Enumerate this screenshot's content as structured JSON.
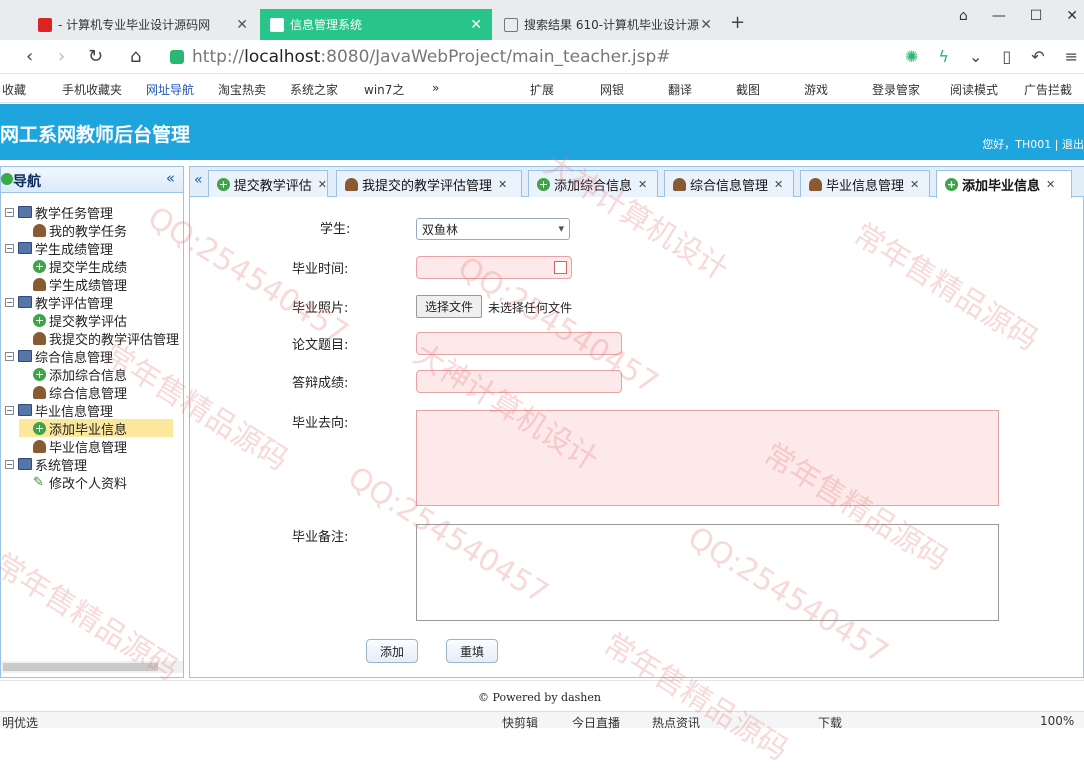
{
  "browser": {
    "tabs": [
      {
        "title": "- 计算机专业毕业设计源码网"
      },
      {
        "title": "信息管理系统"
      },
      {
        "title": "搜索结果 610-计算机毕业设计源"
      }
    ],
    "url_host": "localhost",
    "url_prefix": "http://",
    "url_rest": ":8080/JavaWebProject/main_teacher.jsp#",
    "bookmarks": [
      "收藏",
      "手机收藏夹",
      "网址导航",
      "淘宝热卖",
      "系统之家",
      "win7之",
      "»"
    ],
    "toolbar": [
      "扩展",
      "网银",
      "翻译",
      "截图",
      "游戏",
      "登录管家",
      "阅读模式",
      "广告拦截"
    ]
  },
  "header": {
    "title": "网工系网教师后台管理",
    "welcome": "您好，TH001 | 退出"
  },
  "sidebar": {
    "title": "导航",
    "groups": [
      {
        "label": "教学任务管理",
        "items": [
          {
            "label": "我的教学任务",
            "icon": "person-icon"
          }
        ]
      },
      {
        "label": "学生成绩管理",
        "items": [
          {
            "label": "提交学生成绩",
            "icon": "add-icon"
          },
          {
            "label": "学生成绩管理",
            "icon": "person-icon"
          }
        ]
      },
      {
        "label": "教学评估管理",
        "items": [
          {
            "label": "提交教学评估",
            "icon": "add-icon"
          },
          {
            "label": "我提交的教学评估管理",
            "icon": "person-icon"
          }
        ]
      },
      {
        "label": "综合信息管理",
        "items": [
          {
            "label": "添加综合信息",
            "icon": "add-icon"
          },
          {
            "label": "综合信息管理",
            "icon": "person-icon"
          }
        ]
      },
      {
        "label": "毕业信息管理",
        "items": [
          {
            "label": "添加毕业信息",
            "icon": "add-icon",
            "selected": true
          },
          {
            "label": "毕业信息管理",
            "icon": "person-icon"
          }
        ]
      },
      {
        "label": "系统管理",
        "items": [
          {
            "label": "修改个人资料",
            "icon": "pencil-icon"
          }
        ]
      }
    ]
  },
  "tabs": [
    {
      "label": "提交教学评估",
      "icon": "add-icon"
    },
    {
      "label": "我提交的教学评估管理",
      "icon": "person-icon"
    },
    {
      "label": "添加综合信息",
      "icon": "add-icon"
    },
    {
      "label": "综合信息管理",
      "icon": "person-icon"
    },
    {
      "label": "毕业信息管理",
      "icon": "person-icon"
    },
    {
      "label": "添加毕业信息",
      "icon": "add-icon",
      "active": true
    }
  ],
  "form": {
    "student_label": "学生:",
    "student_value": "双鱼林",
    "time_label": "毕业时间:",
    "time_value": "",
    "photo_label": "毕业照片:",
    "file_button": "选择文件",
    "file_status": "未选择任何文件",
    "thesis_label": "论文题目:",
    "thesis_value": "",
    "defense_label": "答辩成绩:",
    "defense_value": "",
    "destination_label": "毕业去向:",
    "destination_value": "",
    "remark_label": "毕业备注:",
    "remark_value": "",
    "add_button": "添加",
    "reset_button": "重填"
  },
  "footer": {
    "text": "© Powered by dashen"
  },
  "statusbar": [
    "明优选",
    "快剪辑",
    "今日直播",
    "热点资讯",
    "下载",
    "100%"
  ],
  "watermarks": [
    "常年售精品源码",
    "QQ:254540457",
    "大神计算机设计"
  ],
  "colors": {
    "header_bg": "#1fa5dd",
    "active_browser_tab": "#28c58a",
    "invalid_field": "#fde9e9"
  }
}
